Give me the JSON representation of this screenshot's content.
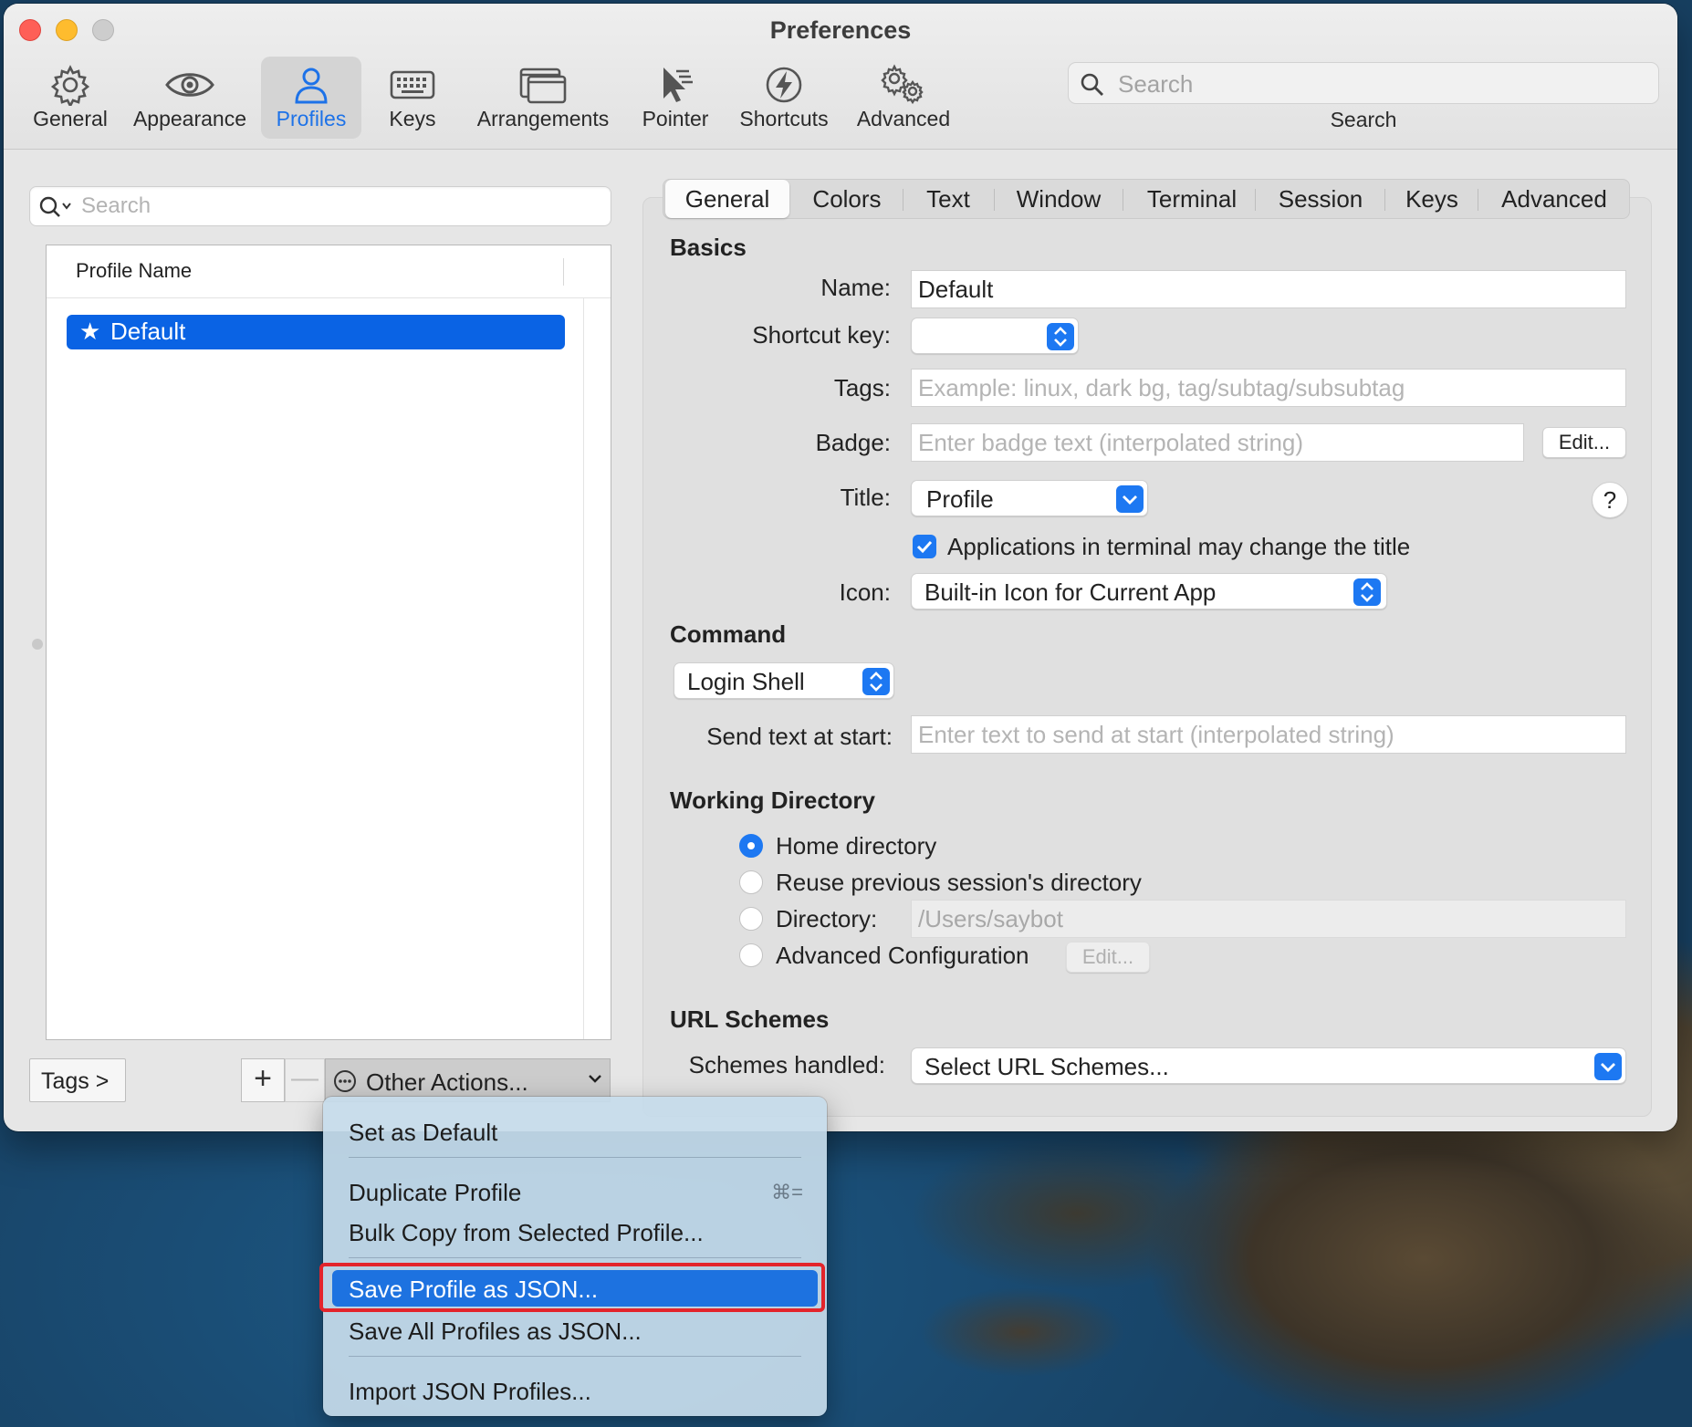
{
  "window": {
    "title": "Preferences"
  },
  "toolbar": {
    "items": [
      {
        "label": "General",
        "icon": "gear-icon"
      },
      {
        "label": "Appearance",
        "icon": "eye-icon"
      },
      {
        "label": "Profiles",
        "icon": "person-icon",
        "active": true
      },
      {
        "label": "Keys",
        "icon": "keyboard-icon"
      },
      {
        "label": "Arrangements",
        "icon": "windows-icon"
      },
      {
        "label": "Pointer",
        "icon": "pointer-icon"
      },
      {
        "label": "Shortcuts",
        "icon": "lightning-icon"
      },
      {
        "label": "Advanced",
        "icon": "gears-icon"
      }
    ],
    "search_placeholder": "Search",
    "search_label": "Search"
  },
  "profiles": {
    "search_placeholder": "Search",
    "column_header": "Profile Name",
    "items": [
      {
        "name": "Default",
        "star": "★",
        "selected": true
      }
    ],
    "tags_button": "Tags >",
    "add_button": "+",
    "remove_button": "—",
    "other_actions": "Other Actions..."
  },
  "tabs": [
    "General",
    "Colors",
    "Text",
    "Window",
    "Terminal",
    "Session",
    "Keys",
    "Advanced"
  ],
  "active_tab": "General",
  "basics": {
    "heading": "Basics",
    "name_label": "Name:",
    "name_value": "Default",
    "shortcut_label": "Shortcut key:",
    "shortcut_value": "",
    "tags_label": "Tags:",
    "tags_placeholder": "Example: linux, dark bg, tag/subtag/subsubtag",
    "badge_label": "Badge:",
    "badge_placeholder": "Enter badge text (interpolated string)",
    "badge_edit": "Edit...",
    "title_label": "Title:",
    "title_value": "Profile",
    "help": "?",
    "apps_change_title": "Applications in terminal may change the title",
    "apps_change_title_checked": true,
    "icon_label": "Icon:",
    "icon_value": "Built-in Icon for Current App"
  },
  "command": {
    "heading": "Command",
    "value": "Login Shell",
    "send_text_label": "Send text at start:",
    "send_text_placeholder": "Enter text to send at start (interpolated string)"
  },
  "working_directory": {
    "heading": "Working Directory",
    "options": [
      {
        "label": "Home directory",
        "selected": true
      },
      {
        "label": "Reuse previous session's directory",
        "selected": false
      },
      {
        "label": "Directory:",
        "selected": false
      },
      {
        "label": "Advanced Configuration",
        "selected": false
      }
    ],
    "directory_value": "/Users/saybot",
    "advanced_edit": "Edit..."
  },
  "url_schemes": {
    "heading": "URL Schemes",
    "label": "Schemes handled:",
    "value": "Select URL Schemes..."
  },
  "menu": {
    "items": [
      {
        "label": "Set as Default"
      },
      {
        "label": "Duplicate Profile",
        "shortcut": "⌘="
      },
      {
        "label": "Bulk Copy from Selected Profile..."
      },
      {
        "label": "Save Profile as JSON...",
        "highlighted": true
      },
      {
        "label": "Save All Profiles as JSON..."
      },
      {
        "label": "Import JSON Profiles..."
      }
    ]
  },
  "colors": {
    "accent": "#1d78f2",
    "highlight_box": "#e3242b"
  }
}
